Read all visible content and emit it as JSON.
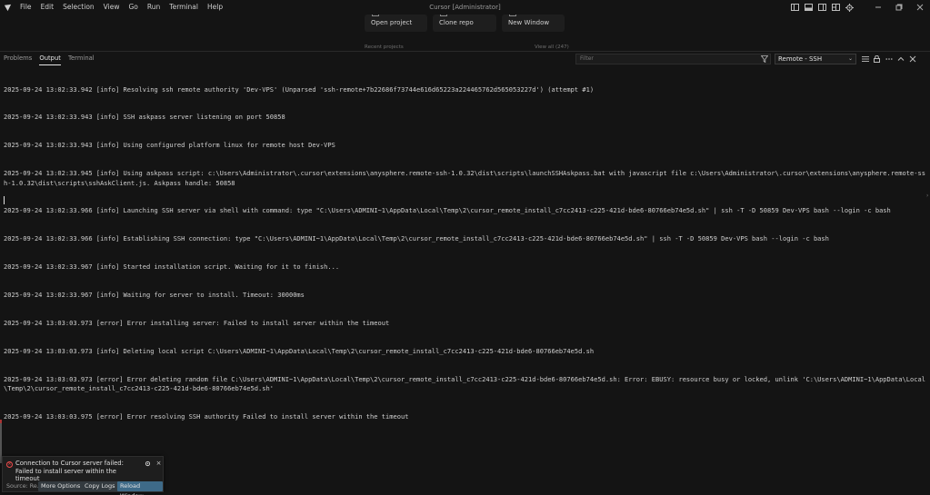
{
  "window": {
    "title": "Cursor [Administrator]",
    "menu": [
      "File",
      "Edit",
      "Selection",
      "View",
      "Go",
      "Run",
      "Terminal",
      "Help"
    ]
  },
  "welcome": {
    "cards": [
      "Open project",
      "Clone repo",
      "New Window"
    ],
    "recent_label": "Recent projects",
    "view_all": "View all (247)"
  },
  "panel": {
    "tabs": [
      "Problems",
      "Output",
      "Terminal"
    ],
    "active_tab": "Output",
    "filter_placeholder": "Filter",
    "channel": "Remote - SSH"
  },
  "log_lines": [
    "2025-09-24 13:02:33.942 [info] Resolving ssh remote authority 'Dev-VPS' (Unparsed 'ssh-remote+7b22686f73744e616d65223a224465762d565053227d') (attempt #1)",
    "2025-09-24 13:02:33.943 [info] SSH askpass server listening on port 50858",
    "2025-09-24 13:02:33.943 [info] Using configured platform linux for remote host Dev-VPS",
    "2025-09-24 13:02:33.945 [info] Using askpass script: c:\\Users\\Administrator\\.cursor\\extensions\\anysphere.remote-ssh-1.0.32\\dist\\scripts\\launchSSHAskpass.bat with javascript file c:\\Users\\Administrator\\.cursor\\extensions\\anysphere.remote-ssh-1.0.32\\dist\\scripts\\sshAskClient.js. Askpass handle: 50858",
    "2025-09-24 13:02:33.966 [info] Launching SSH server via shell with command: type \"C:\\Users\\ADMINI~1\\AppData\\Local\\Temp\\2\\cursor_remote_install_c7cc2413-c225-421d-bde6-80766eb74e5d.sh\" | ssh -T -D 50859 Dev-VPS bash --login -c bash",
    "2025-09-24 13:02:33.966 [info] Establishing SSH connection: type \"C:\\Users\\ADMINI~1\\AppData\\Local\\Temp\\2\\cursor_remote_install_c7cc2413-c225-421d-bde6-80766eb74e5d.sh\" | ssh -T -D 50859 Dev-VPS bash --login -c bash",
    "2025-09-24 13:02:33.967 [info] Started installation script. Waiting for it to finish...",
    "2025-09-24 13:02:33.967 [info] Waiting for server to install. Timeout: 30000ms",
    "2025-09-24 13:03:03.973 [error] Error installing server: Failed to install server within the timeout",
    "2025-09-24 13:03:03.973 [info] Deleting local script C:\\Users\\ADMINI~1\\AppData\\Local\\Temp\\2\\cursor_remote_install_c7cc2413-c225-421d-bde6-80766eb74e5d.sh",
    "2025-09-24 13:03:03.973 [error] Error deleting random file C:\\Users\\ADMINI~1\\AppData\\Local\\Temp\\2\\cursor_remote_install_c7cc2413-c225-421d-bde6-80766eb74e5d.sh: Error: EBUSY: resource busy or locked, unlink 'C:\\Users\\ADMINI~1\\AppData\\Local\\Temp\\2\\cursor_remote_install_c7cc2413-c225-421d-bde6-80766eb74e5d.sh'",
    "2025-09-24 13:03:03.975 [error] Error resolving SSH authority Failed to install server within the timeout"
  ],
  "notification": {
    "message": "Connection to Cursor server failed: Failed to install server within the timeout",
    "source": "Source: Re...",
    "buttons": [
      "More Options",
      "Copy Logs",
      "Reload Window"
    ]
  },
  "colors": {
    "background": "#141414",
    "error": "#f14c4c",
    "primary_button": "#3e6a88"
  }
}
